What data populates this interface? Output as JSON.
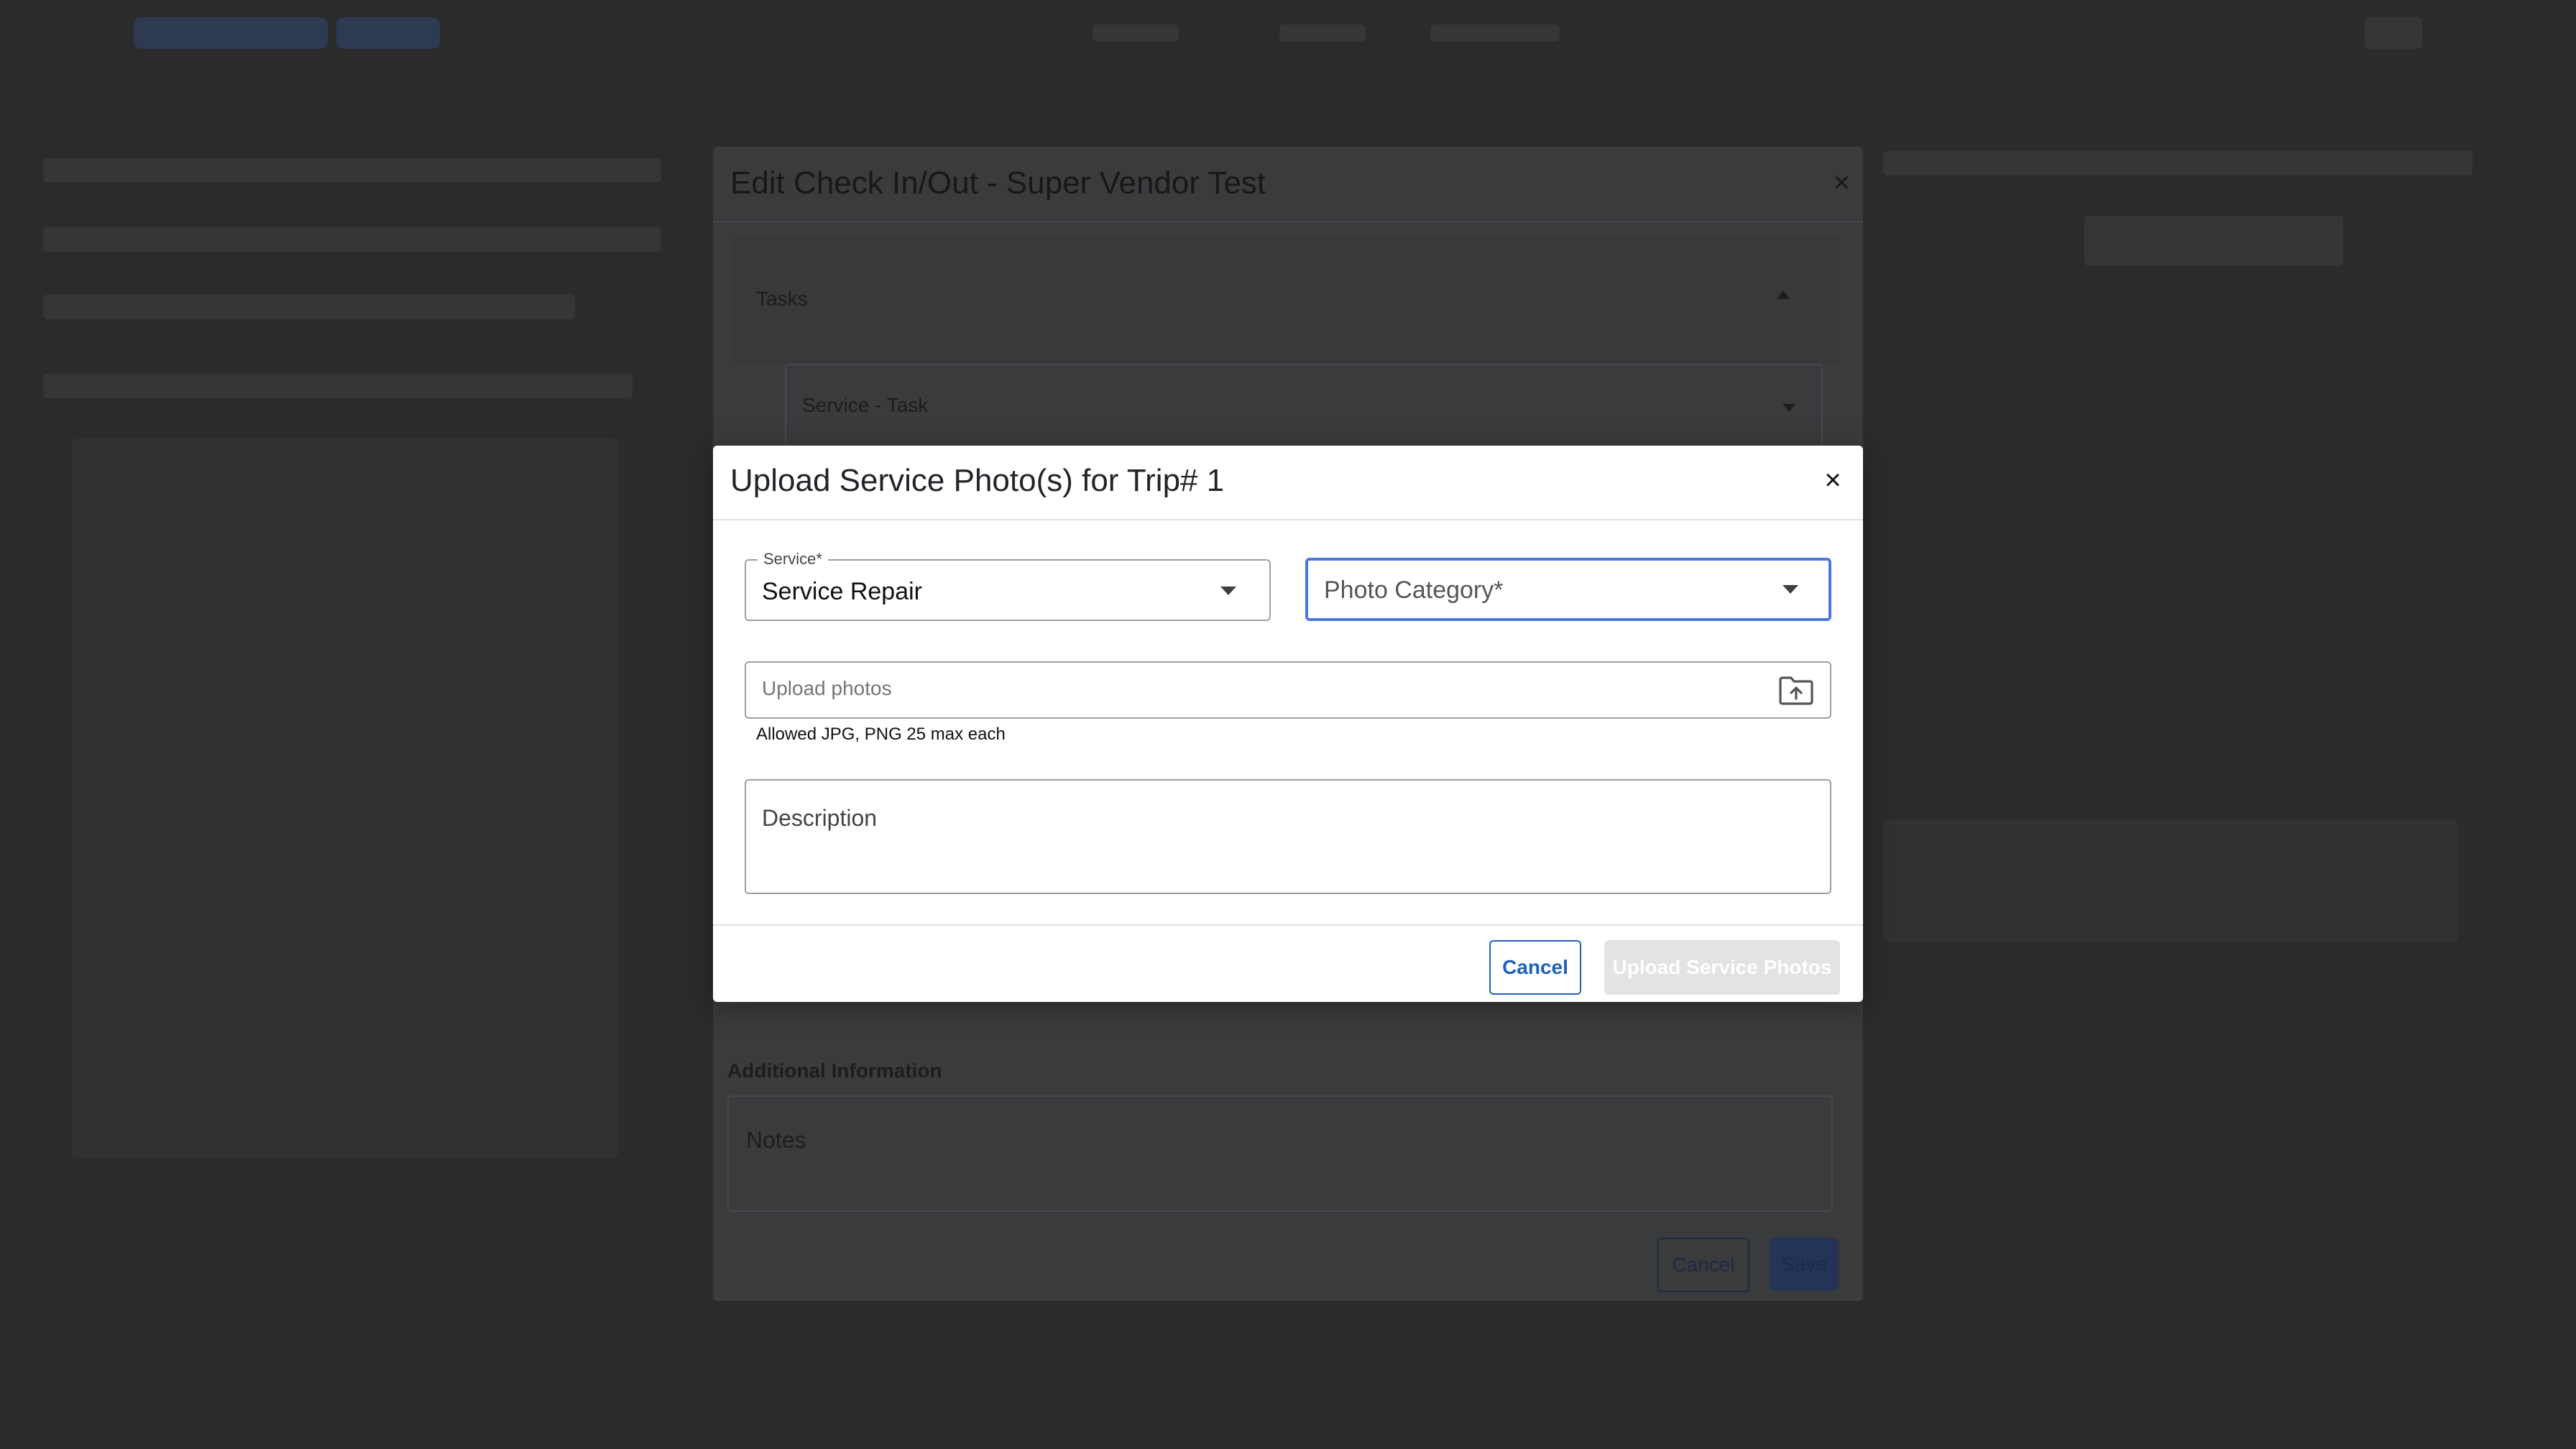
{
  "edit_modal": {
    "title": "Edit Check In/Out - Super Vendor Test",
    "close_label": "×",
    "tasks_label": "Tasks",
    "service_task_placeholder": "Service - Task",
    "additional_info_title": "Additional Information",
    "notes_placeholder": "Notes",
    "cancel_label": "Cancel",
    "save_label": "Save"
  },
  "upload_modal": {
    "title": "Upload Service Photo(s) for Trip# 1",
    "close_label": "×",
    "service_field": {
      "label": "Service*",
      "value": "Service Repair"
    },
    "photo_category_field": {
      "placeholder": "Photo Category*"
    },
    "upload_field": {
      "placeholder": "Upload photos",
      "hint": "Allowed JPG, PNG 25 max each"
    },
    "description_field": {
      "placeholder": "Description"
    },
    "footer": {
      "cancel_label": "Cancel",
      "upload_label": "Upload Service Photos"
    }
  },
  "colors": {
    "overlay_bg": "#2a2a2b",
    "focus_border": "#4a78d8",
    "primary": "#1f5fbf",
    "disabled_button": "#e2e3e5"
  },
  "icons": {
    "close": "close-icon",
    "caret": "caret-down-icon",
    "upload": "folder-upload-icon"
  }
}
